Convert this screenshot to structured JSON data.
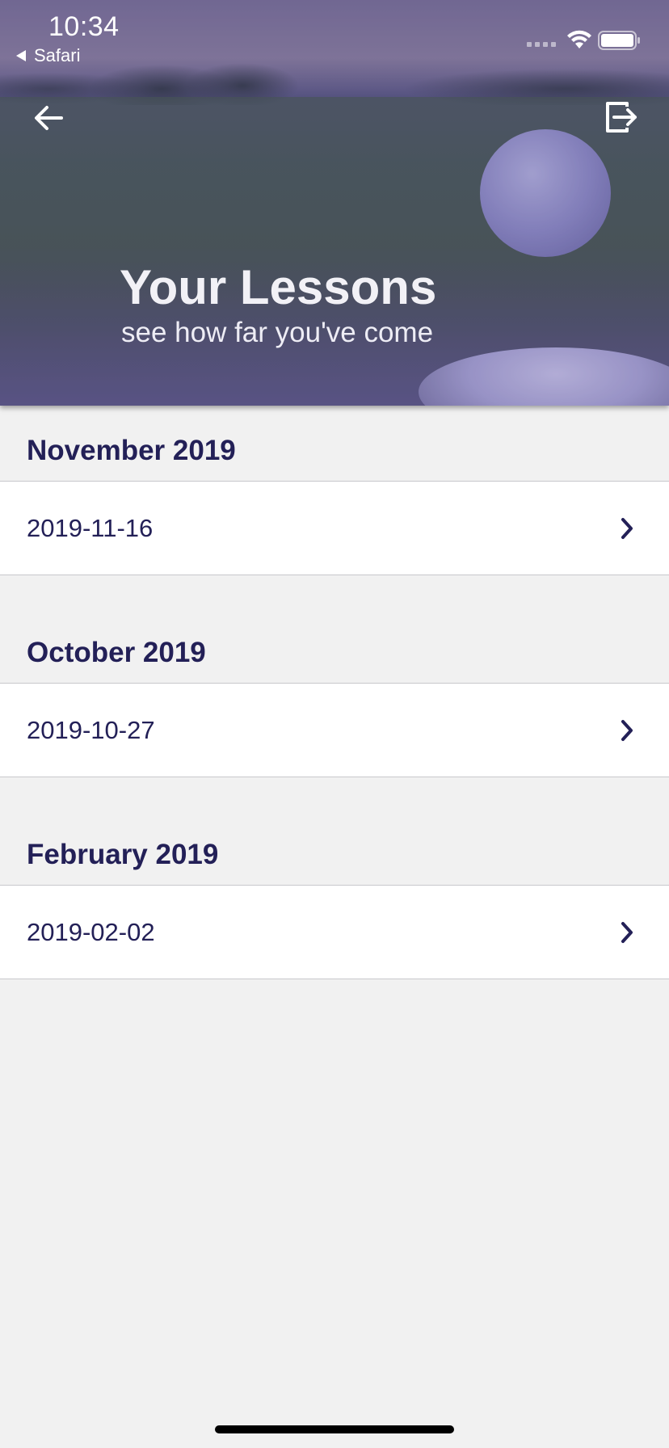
{
  "status_bar": {
    "time": "10:34",
    "back_app": "Safari"
  },
  "header": {
    "title": "Your Lessons",
    "subtitle": "see how far you've come",
    "back_icon": "arrow-left-icon",
    "exit_icon": "exit-icon"
  },
  "sections": [
    {
      "title": "November 2019",
      "lessons": [
        {
          "date": "2019-11-16"
        }
      ]
    },
    {
      "title": "October 2019",
      "lessons": [
        {
          "date": "2019-10-27"
        }
      ]
    },
    {
      "title": "February 2019",
      "lessons": [
        {
          "date": "2019-02-02"
        }
      ]
    }
  ],
  "colors": {
    "accent": "#232057",
    "background": "#f1f1f1",
    "row_background": "#ffffff"
  }
}
